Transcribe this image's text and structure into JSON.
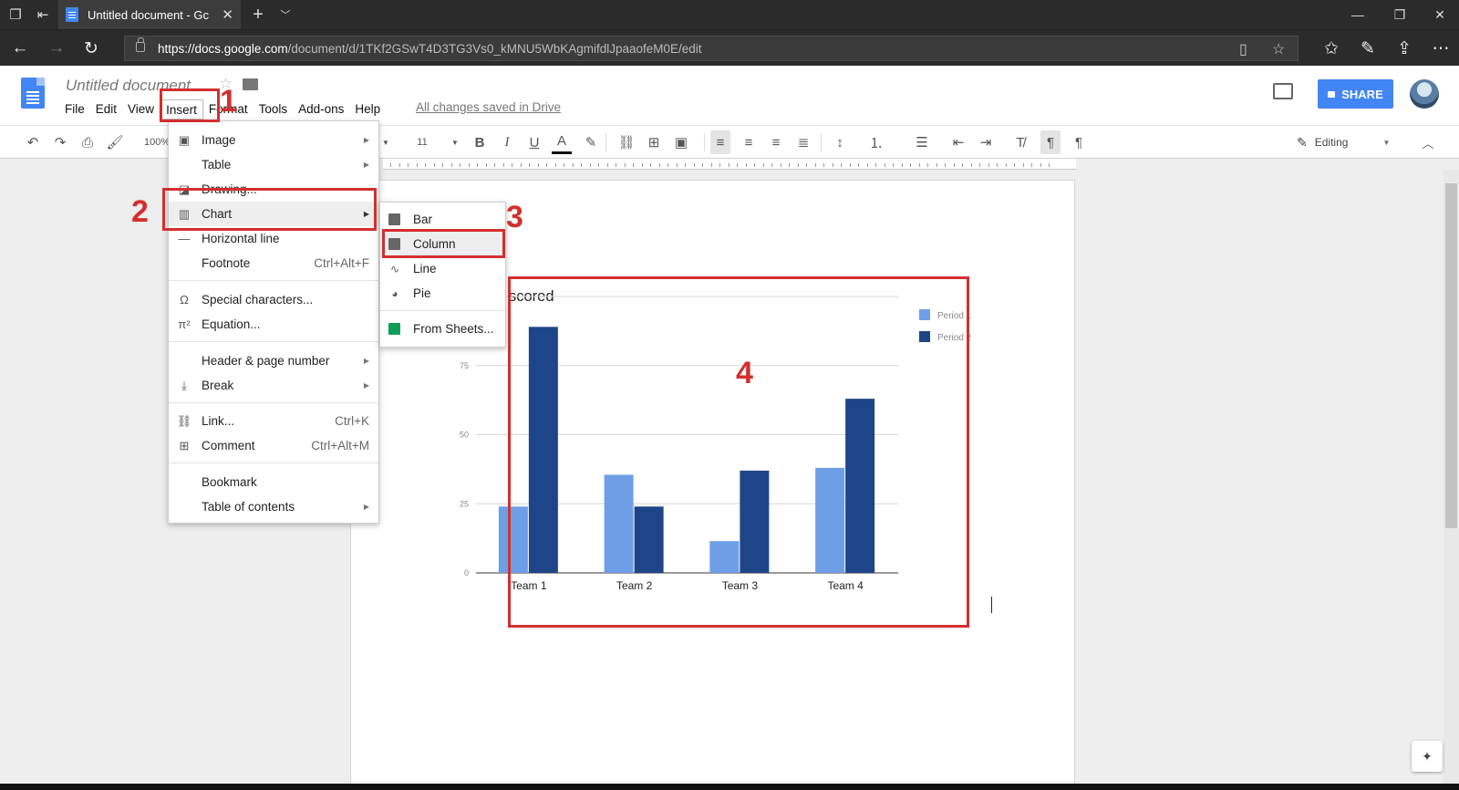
{
  "browser": {
    "tab_title": "Untitled document - Gc",
    "url_host": "https://docs.google.com",
    "url_path": "/document/d/1TKf2GSwT4D3TG3Vs0_kMNU5WbKAgmifdlJpaaofeM0E/edit"
  },
  "docs": {
    "title": "Untitled document",
    "saved_status": "All changes saved in Drive",
    "share_label": "SHARE",
    "menu": [
      "File",
      "Edit",
      "View",
      "Insert",
      "Format",
      "Tools",
      "Add-ons",
      "Help"
    ],
    "zoom": "100%",
    "font_size": "11",
    "mode_label": "Editing"
  },
  "insert_menu": {
    "items": [
      {
        "label": "Image",
        "icon": "image-icon",
        "submenu": true
      },
      {
        "label": "Table",
        "submenu": true
      },
      {
        "label": "Drawing...",
        "icon": "drawing-icon"
      },
      {
        "label": "Chart",
        "icon": "chart-icon",
        "submenu": true
      },
      {
        "label": "Horizontal line",
        "icon": "horizontal-line-icon"
      },
      {
        "label": "Footnote",
        "shortcut": "Ctrl+Alt+F"
      },
      {
        "label": "Special characters...",
        "icon": "omega-icon"
      },
      {
        "label": "Equation...",
        "icon": "pi-icon"
      },
      {
        "label": "Header & page number",
        "submenu": true
      },
      {
        "label": "Break",
        "icon": "break-icon",
        "submenu": true
      },
      {
        "label": "Link...",
        "icon": "link-icon",
        "shortcut": "Ctrl+K"
      },
      {
        "label": "Comment",
        "icon": "comment-icon",
        "shortcut": "Ctrl+Alt+M"
      },
      {
        "label": "Bookmark"
      },
      {
        "label": "Table of contents",
        "submenu": true
      }
    ]
  },
  "chart_submenu": {
    "items": [
      {
        "label": "Bar",
        "icon": "bar-chart-icon"
      },
      {
        "label": "Column",
        "icon": "column-chart-icon"
      },
      {
        "label": "Line",
        "icon": "line-chart-icon"
      },
      {
        "label": "Pie",
        "icon": "pie-chart-icon"
      },
      {
        "label": "From Sheets...",
        "icon": "sheets-icon"
      }
    ]
  },
  "annotations": [
    "1",
    "2",
    "3",
    "4"
  ],
  "colors": {
    "accent": "#4285f4",
    "annotation": "#d32f2f",
    "period1": "#6e9fe6",
    "period2": "#1f4589"
  },
  "chart_data": {
    "type": "bar",
    "title": "scored",
    "categories": [
      "Team 1",
      "Team 2",
      "Team 3",
      "Team 4"
    ],
    "series": [
      {
        "name": "Period 1",
        "values": [
          24,
          35.5,
          11.5,
          38
        ]
      },
      {
        "name": "Period 2",
        "values": [
          89,
          24,
          37,
          63
        ]
      }
    ],
    "yticks": [
      0,
      25,
      50,
      75
    ],
    "ylim": [
      0,
      100
    ],
    "grid": true,
    "legend": "right"
  }
}
